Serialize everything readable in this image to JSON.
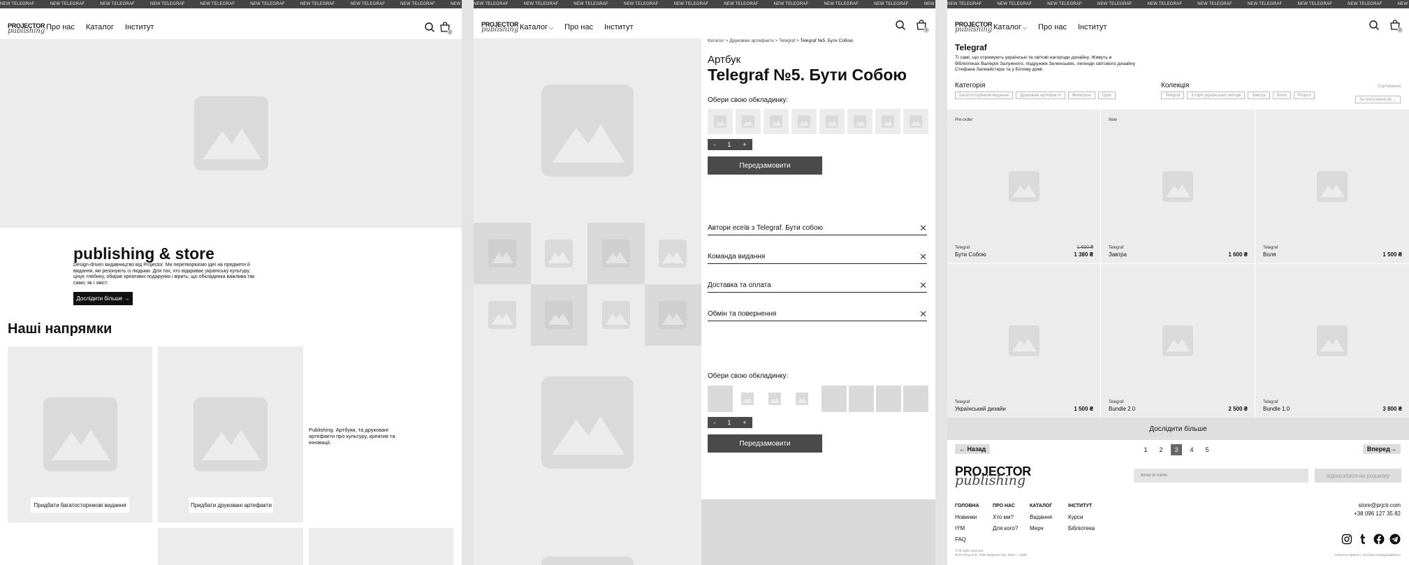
{
  "ticker": "NEW TELEGRAF",
  "logo": {
    "line1": "PROJECTOR",
    "line2": "publishing"
  },
  "nav": {
    "about": "Про нас",
    "catalog": "Каталог",
    "institute": "Інститут"
  },
  "cart_count": "1",
  "home": {
    "hero_title": "publishing & store",
    "hero_text": "Design-driven видавництво від Projector. Ми перетворюємо ідеї на предмети й видання, які резонують із людьми. Для тих, хто відкриває українську культуру, цінує глибину, обирає креативні подарунки і вірить, що обкладинка важлива так само, як і зміст.",
    "hero_button": "Дослідити більше →",
    "directions_title": "Наші напрямки",
    "card1_button": "Придбати багатосторінкові видання",
    "card2_button": "Придбати друковані артефакти",
    "publishing_text": "Publishing. Артбуки, та друковані артефакти про культуру, креатив та інновації."
  },
  "product": {
    "breadcrumb": [
      "Каталог",
      "Друковані артефакти",
      "Telegraf",
      "Telegraf №5. Бути Собою"
    ],
    "breadcrumb_sep": ">",
    "type": "Артбук",
    "title": "Telegraf №5. Бути Собою",
    "cover_label": "Обери свою обкладинку:",
    "qty": {
      "minus": "-",
      "value": "1",
      "plus": "+"
    },
    "preorder_button": "Передзамовити",
    "accordions": [
      "Автори есеїв з Telegraf. Бути собою",
      "Команда видання",
      "Доставка та оплата",
      "Обмін та повернення"
    ],
    "close_glyph": "✕"
  },
  "catalog": {
    "title": "Telegraf",
    "description": "Ті самі, що отримують українські та світові нагороди дизайну. Живуть в бібліотеках Валерія Залужного, подружжя Зеленських, легенди світового дизайну Стефана Загмайстера та у Білому домі.",
    "category_label": "Категорія",
    "categories": [
      "Багатосторінкові видання",
      "Друковані артефакти",
      "Фелетрон",
      "Одяг"
    ],
    "collection_label": "Колекція",
    "collections": [
      "Telegraf",
      "Історії українських митців",
      "Завтра",
      "Воля",
      "Project"
    ],
    "sort_label": "Сортування",
    "sort_value": "За популярністю ⌄",
    "products": [
      {
        "tag": "Pre-order",
        "series": "Telegraf",
        "name": "Бути Собою",
        "price": "1 380 ₴",
        "old": "1 600 ₴"
      },
      {
        "tag": "New",
        "series": "Telegraf",
        "name": "Завтра",
        "price": "1 600 ₴",
        "old": ""
      },
      {
        "tag": "",
        "series": "Telegraf",
        "name": "Воля",
        "price": "1 500 ₴",
        "old": ""
      },
      {
        "tag": "",
        "series": "Telegraf",
        "name": "Український дизайн",
        "price": "1 500 ₴",
        "old": ""
      },
      {
        "tag": "",
        "series": "Telegraf",
        "name": "Bundle 2.0",
        "price": "2 500 ₴",
        "old": ""
      },
      {
        "tag": "",
        "series": "Telegraf",
        "name": "Bundle 1.0",
        "price": "3 800 ₴",
        "old": ""
      }
    ],
    "more_button": "Дослідити більше",
    "back": "← Назад",
    "forward": "Вперед→",
    "pages": [
      "1",
      "2",
      "3",
      "4",
      "5"
    ],
    "active_page": "3"
  },
  "footer": {
    "email_placeholder": "email or name",
    "subscribe": "підписатися на розсилку",
    "cols": [
      {
        "head": "ГОЛОВНА",
        "items": [
          "Новинки",
          "IYM",
          "FAQ"
        ]
      },
      {
        "head": "ПРО НАС",
        "items": [
          "Хто ми?",
          "Для кого?"
        ]
      },
      {
        "head": "КАТАЛОГ",
        "items": [
          "Видання",
          "Мерч"
        ]
      },
      {
        "head": "ІНСТИТУТ",
        "items": [
          "Курси",
          "Бібліотека"
        ]
      }
    ],
    "email": "store@prjctr.com",
    "phone": "+38 096 127 35 82",
    "rights": "© All rights reserved",
    "company": "ФОП 'Кічук О.В.' ТОВ 'Ведення Тор', 2022 — 2025",
    "legal": "Публічна оферта | Політика конфіденційності"
  }
}
